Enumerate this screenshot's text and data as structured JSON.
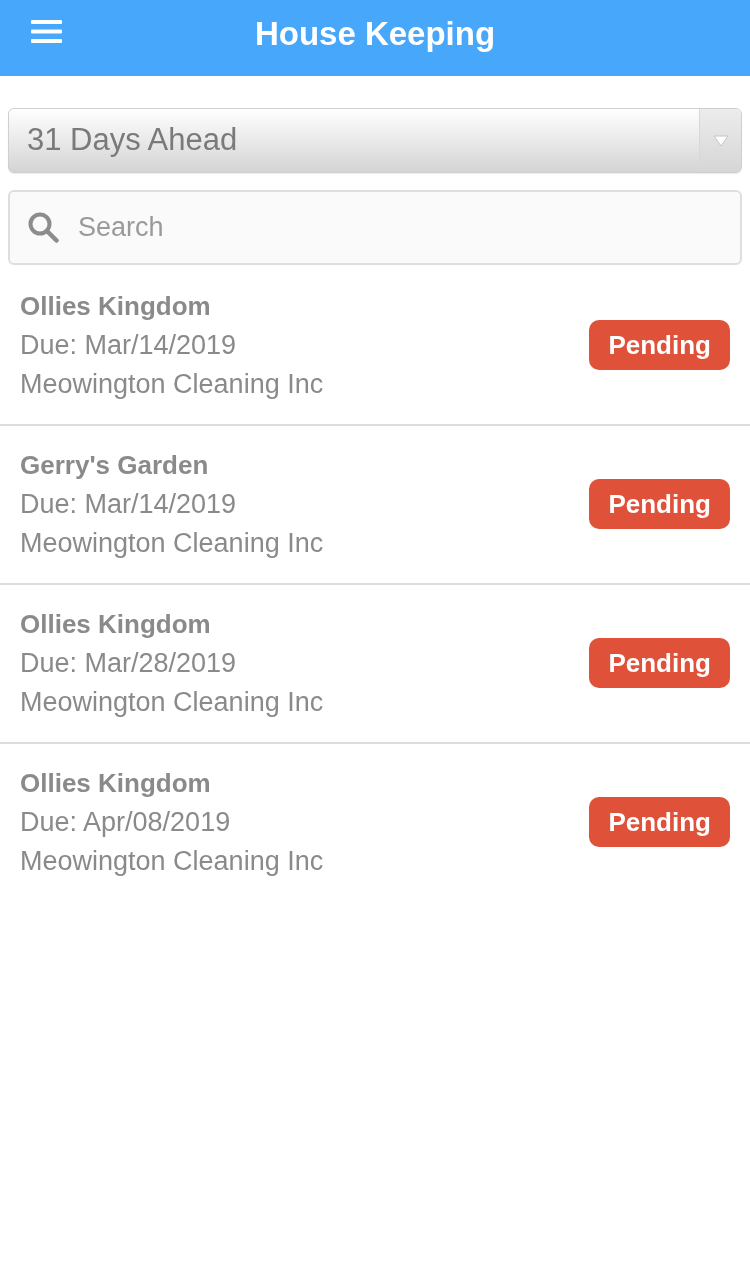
{
  "header": {
    "title": "House Keeping"
  },
  "filter": {
    "value": "31 Days Ahead"
  },
  "search": {
    "placeholder": "Search"
  },
  "tasks": [
    {
      "title": "Ollies Kingdom",
      "due": "Due: Mar/14/2019",
      "company": "Meowington Cleaning Inc",
      "status": "Pending"
    },
    {
      "title": "Gerry's Garden",
      "due": "Due: Mar/14/2019",
      "company": "Meowington Cleaning Inc",
      "status": "Pending"
    },
    {
      "title": "Ollies Kingdom",
      "due": "Due: Mar/28/2019",
      "company": "Meowington Cleaning Inc",
      "status": "Pending"
    },
    {
      "title": "Ollies Kingdom",
      "due": "Due: Apr/08/2019",
      "company": "Meowington Cleaning Inc",
      "status": "Pending"
    }
  ]
}
